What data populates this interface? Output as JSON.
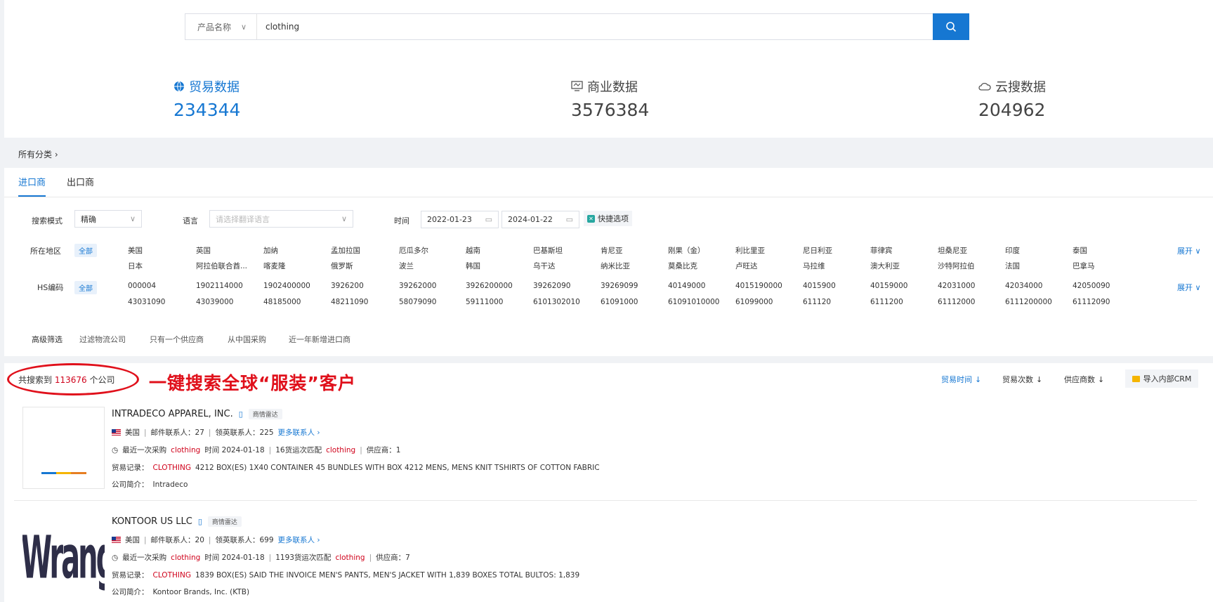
{
  "search": {
    "field_select": "产品名称",
    "query": "clothing"
  },
  "stats": {
    "trade": {
      "label": "贸易数据",
      "value": "234344"
    },
    "business": {
      "label": "商业数据",
      "value": "3576384"
    },
    "cloud": {
      "label": "云搜数据",
      "value": "204962"
    }
  },
  "breadcrumb": "所有分类",
  "tabs": [
    "进口商",
    "出口商"
  ],
  "filters": {
    "search_mode_label": "搜索模式",
    "search_mode_value": "精确",
    "language_label": "语言",
    "language_placeholder": "请选择翻译语言",
    "time_label": "时间",
    "date_from": "2022-01-23",
    "date_to": "2024-01-22",
    "quick_label": "快捷选项",
    "region_label": "所在地区",
    "all_label": "全部",
    "regions_row1": [
      "美国",
      "英国",
      "加纳",
      "孟加拉国",
      "厄瓜多尔",
      "越南",
      "巴基斯坦",
      "肯尼亚",
      "刚果（金）",
      "利比里亚",
      "尼日利亚",
      "菲律宾",
      "坦桑尼亚",
      "印度",
      "泰国"
    ],
    "regions_row2": [
      "日本",
      "阿拉伯联合酋...",
      "喀麦隆",
      "俄罗斯",
      "波兰",
      "韩国",
      "乌干达",
      "纳米比亚",
      "莫桑比克",
      "卢旺达",
      "马拉维",
      "澳大利亚",
      "沙特阿拉伯",
      "法国",
      "巴拿马"
    ],
    "hs_label": "HS编码",
    "hs_row1": [
      "000004",
      "1902114000",
      "1902400000",
      "3926200",
      "39262000",
      "3926200000",
      "39262090",
      "39269099",
      "40149000",
      "4015190000",
      "4015900",
      "40159000",
      "42031000",
      "42034000",
      "42050090"
    ],
    "hs_row2": [
      "43031090",
      "43039000",
      "48185000",
      "48211090",
      "58079090",
      "59111000",
      "6101302010",
      "61091000",
      "61091010000",
      "61099000",
      "611120",
      "6111200",
      "61112000",
      "6111200000",
      "61112090"
    ],
    "expand_label": "展开",
    "advanced_label": "高级筛选",
    "advanced_options": [
      "过滤物流公司",
      "只有一个供应商",
      "从中国采购",
      "近一年新增进口商"
    ]
  },
  "results": {
    "count_prefix": "共搜索到",
    "count": "113676",
    "count_suffix": "个公司",
    "promo": "一键搜索全球“服装”客户",
    "sort": [
      "贸易时间",
      "贸易次数",
      "供应商数"
    ],
    "crm_button": "导入内部CRM"
  },
  "companies": [
    {
      "name": "INTRADECO APPAREL, INC.",
      "radar": "商情雷达",
      "country": "美国",
      "email_contacts": "邮件联系人：27",
      "linkedin_contacts": "领英联系人：225",
      "more_contacts": "更多联系人",
      "last_purchase_prefix": "最近一次采购",
      "last_purchase_term": "clothing",
      "last_purchase_time": "时间 2024-01-18",
      "match_prefix": "16货运次匹配",
      "match_term": "clothing",
      "suppliers": "供应商：1",
      "trade_label": "贸易记录：",
      "trade_term": "CLOTHING",
      "trade_text": "4212 BOX(ES) 1X40 CONTAINER 45 BUNDLES WITH BOX 4212 MENS, MENS KNIT TSHIRTS OF COTTON FABRIC",
      "intro_label": "公司简介：",
      "intro": "Intradeco"
    },
    {
      "name": "KONTOOR US LLC",
      "radar": "商情雷达",
      "country": "美国",
      "email_contacts": "邮件联系人：20",
      "linkedin_contacts": "领英联系人：699",
      "more_contacts": "更多联系人",
      "last_purchase_prefix": "最近一次采购",
      "last_purchase_term": "clothing",
      "last_purchase_time": "时间 2024-01-18",
      "match_prefix": "1193货运次匹配",
      "match_term": "clothing",
      "suppliers": "供应商：7",
      "trade_label": "贸易记录：",
      "trade_term": "CLOTHING",
      "trade_text": "1839 BOX(ES) SAID THE INVOICE MEN'S PANTS, MEN'S JACKET WITH 1,839 BOXES TOTAL BULTOS: 1,839",
      "intro_label": "公司简介：",
      "intro": "Kontoor Brands, Inc. (KTB)",
      "logo_text": "Wrangler"
    }
  ],
  "colors": {
    "accent": "#1677d2",
    "highlight": "#d0021b",
    "promo": "#e0101b"
  }
}
